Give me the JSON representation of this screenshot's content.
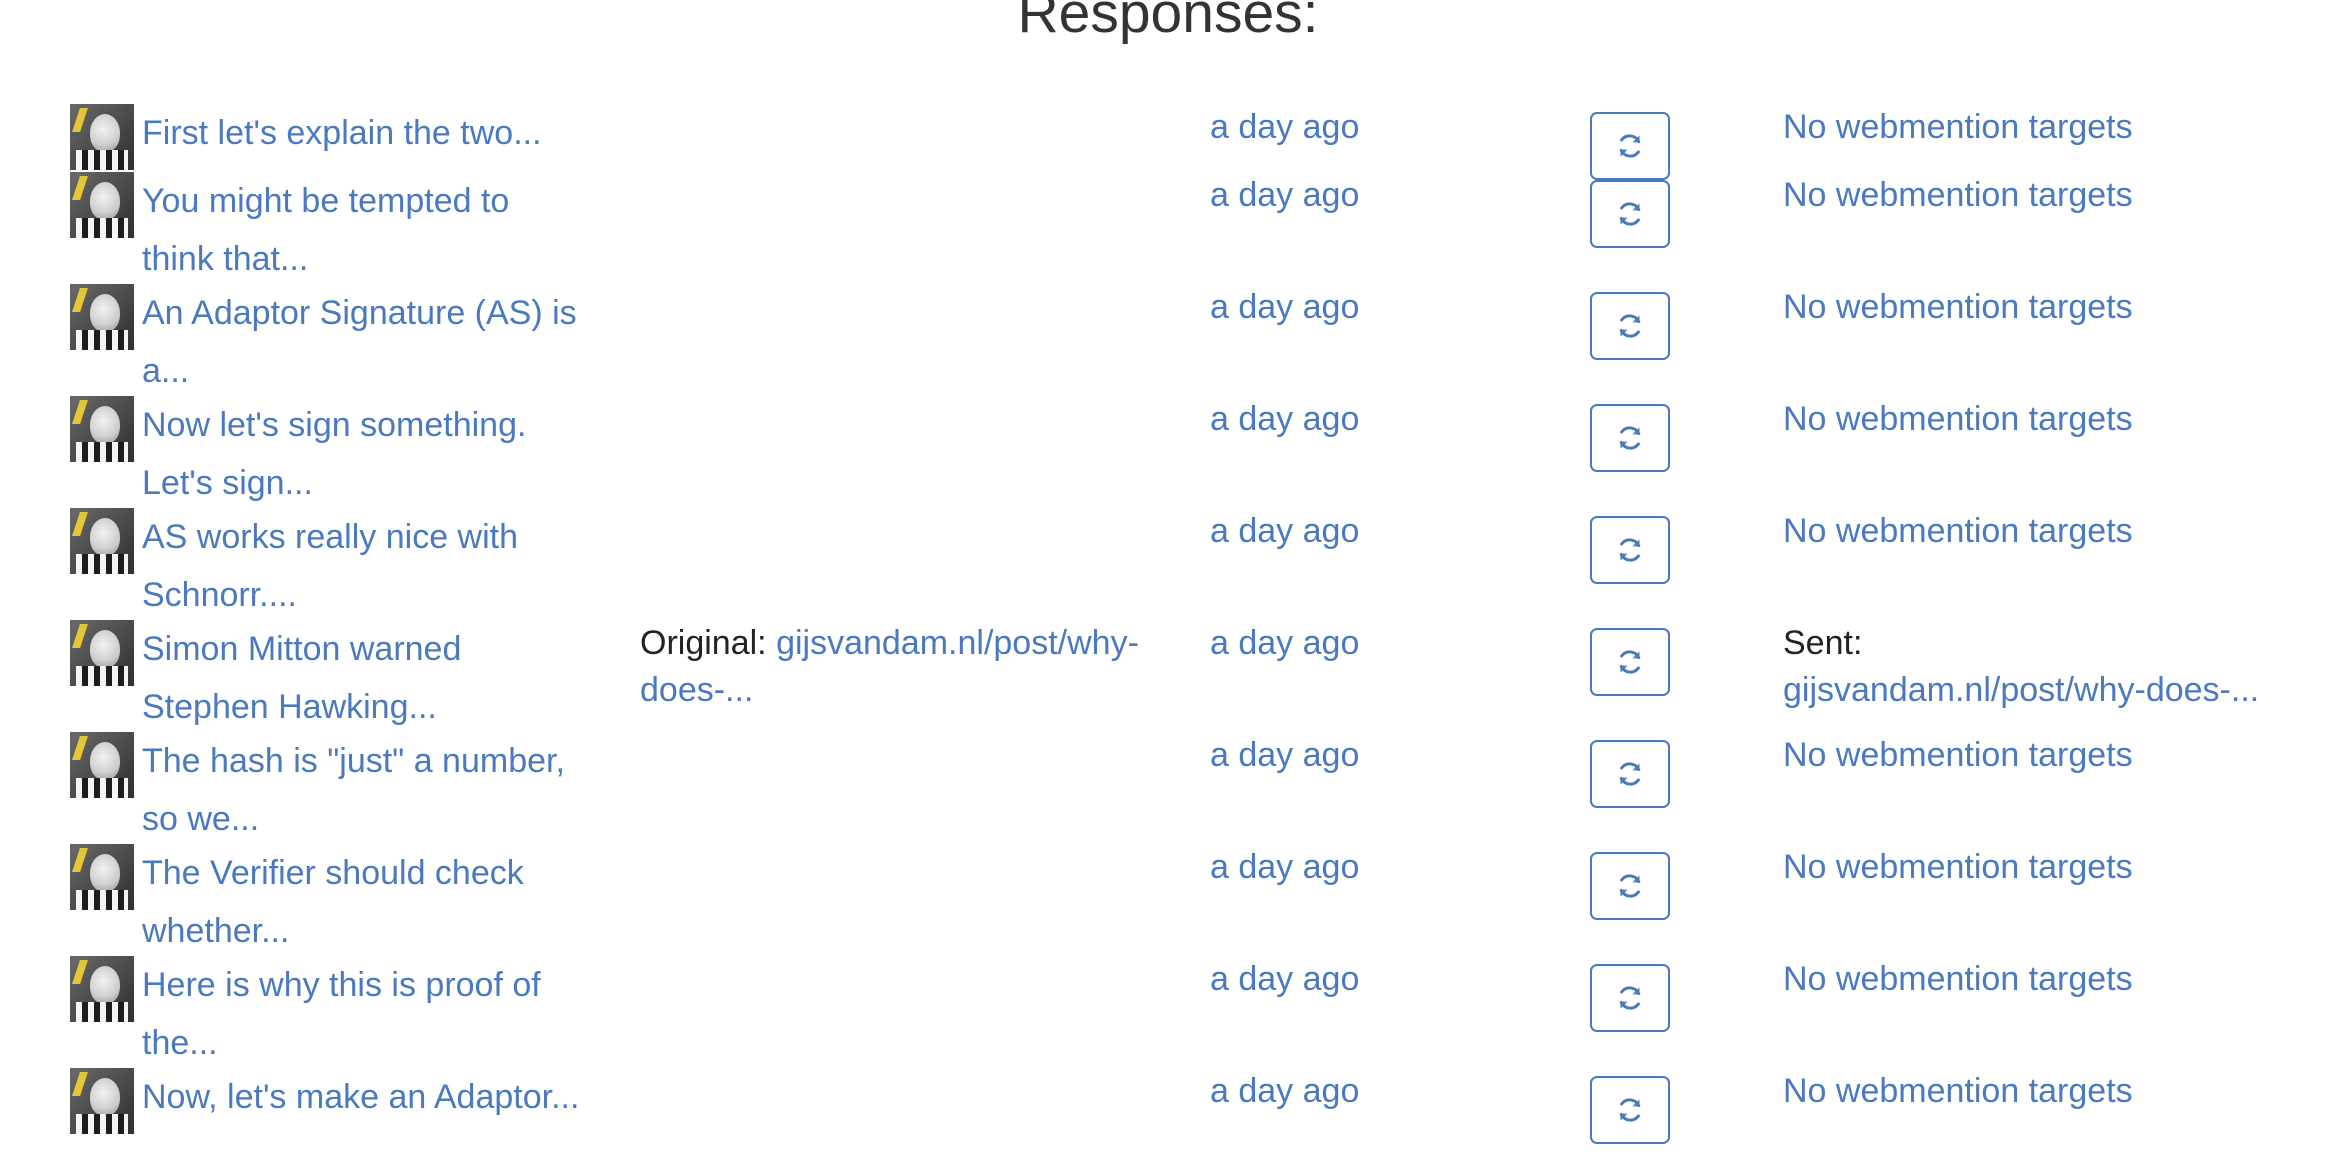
{
  "page": {
    "heading": "Responses:"
  },
  "colors": {
    "accent": "#4a79bf",
    "text": "#333333"
  },
  "rows": [
    {
      "content": "First let's explain the two...",
      "original_label": "",
      "original_link": "",
      "time": "a day ago",
      "refresh_icon": "refresh-icon",
      "status_label": "",
      "status_text": "No webmention targets"
    },
    {
      "content": "You might be tempted to think that...",
      "original_label": "",
      "original_link": "",
      "time": "a day ago",
      "refresh_icon": "refresh-icon",
      "status_label": "",
      "status_text": "No webmention targets"
    },
    {
      "content": "An Adaptor Signature (AS) is a...",
      "original_label": "",
      "original_link": "",
      "time": "a day ago",
      "refresh_icon": "refresh-icon",
      "status_label": "",
      "status_text": "No webmention targets"
    },
    {
      "content": "Now let's sign something. Let's sign...",
      "original_label": "",
      "original_link": "",
      "time": "a day ago",
      "refresh_icon": "refresh-icon",
      "status_label": "",
      "status_text": "No webmention targets"
    },
    {
      "content": "AS works really nice with Schnorr....",
      "original_label": "",
      "original_link": "",
      "time": "a day ago",
      "refresh_icon": "refresh-icon",
      "status_label": "",
      "status_text": "No webmention targets"
    },
    {
      "content": "Simon Mitton warned Stephen Hawking...",
      "original_label": "Original:",
      "original_link": "gijsvandam.nl/post/why-does-...",
      "time": "a day ago",
      "refresh_icon": "refresh-icon",
      "status_label": "Sent:",
      "status_text": "gijsvandam.nl/post/why-does-..."
    },
    {
      "content": "The hash is \"just\" a number, so we...",
      "original_label": "",
      "original_link": "",
      "time": "a day ago",
      "refresh_icon": "refresh-icon",
      "status_label": "",
      "status_text": "No webmention targets"
    },
    {
      "content": "The Verifier should check whether...",
      "original_label": "",
      "original_link": "",
      "time": "a day ago",
      "refresh_icon": "refresh-icon",
      "status_label": "",
      "status_text": "No webmention targets"
    },
    {
      "content": "Here is why this is proof of the...",
      "original_label": "",
      "original_link": "",
      "time": "a day ago",
      "refresh_icon": "refresh-icon",
      "status_label": "",
      "status_text": "No webmention targets"
    },
    {
      "content": "Now, let's make an Adaptor...",
      "original_label": "",
      "original_link": "",
      "time": "a day ago",
      "refresh_icon": "refresh-icon",
      "status_label": "",
      "status_text": "No webmention targets"
    }
  ]
}
